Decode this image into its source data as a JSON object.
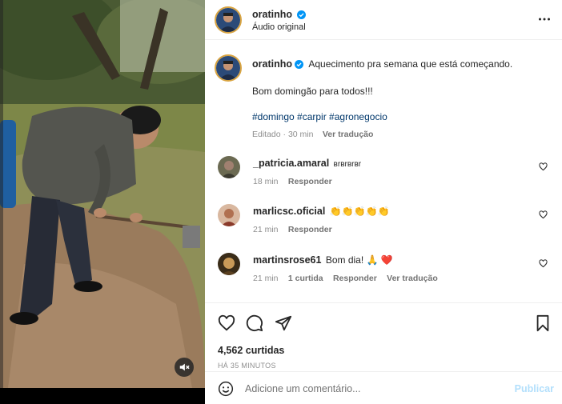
{
  "header": {
    "username": "oratinho",
    "subtitle": "Áudio original",
    "more_icon": "more-horizontal-icon"
  },
  "caption": {
    "username": "oratinho",
    "line1": "Aquecimento pra semana que está começando.",
    "line2": "Bom domingão para todos!!!",
    "hashtags": "#domingo #carpir #agronegocio",
    "meta_edited": "Editado · 30 min",
    "translate": "Ver tradução"
  },
  "comments": [
    {
      "username": "_patricia.amaral",
      "text": "вrвrвrвr",
      "time": "18 min",
      "reply": "Responder",
      "likes_label": "",
      "translate": ""
    },
    {
      "username": "marlicsc.oficial",
      "text": "👏👏👏👏👏",
      "time": "21 min",
      "reply": "Responder",
      "likes_label": "",
      "translate": ""
    },
    {
      "username": "martinsrose61",
      "text": "Bom dia! 🙏 ❤️",
      "time": "21 min",
      "likes_label": "1 curtida",
      "reply": "Responder",
      "translate": "Ver tradução"
    }
  ],
  "actions": {
    "likes": "4,562 curtidas",
    "time_ago": "HÁ 35 MINUTOS"
  },
  "add_comment": {
    "placeholder": "Adicione um comentário...",
    "publish": "Publicar"
  },
  "colors": {
    "verified": "#0095f6",
    "hashtag": "#00376b",
    "heart_red": "#ed4956",
    "publish_disabled": "#b2dffc"
  }
}
